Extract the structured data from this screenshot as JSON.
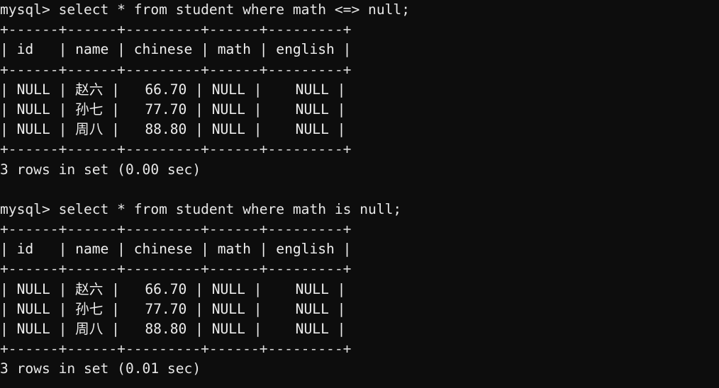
{
  "terminal": {
    "background_color": "#0d0d0d",
    "text_color": "#e8e8e8",
    "prompt": "mysql>",
    "columns": [
      "id",
      "name",
      "chinese",
      "math",
      "english"
    ],
    "separator": "+------+------+---------+------+---------+",
    "header_row": "| id   | name | chinese | math | english |",
    "blank": "",
    "queries": [
      {
        "command_line": "mysql> select * from student where math <=> null;",
        "sql": "select * from student where math <=> null;",
        "rows": [
          "| NULL | 赵六 |   66.70 | NULL |    NULL |",
          "| NULL | 孙七 |   77.70 | NULL |    NULL |",
          "| NULL | 周八 |   88.80 | NULL |    NULL |"
        ],
        "row_values": [
          {
            "id": "NULL",
            "name": "赵六",
            "chinese": "66.70",
            "math": "NULL",
            "english": "NULL"
          },
          {
            "id": "NULL",
            "name": "孙七",
            "chinese": "77.70",
            "math": "NULL",
            "english": "NULL"
          },
          {
            "id": "NULL",
            "name": "周八",
            "chinese": "88.80",
            "math": "NULL",
            "english": "NULL"
          }
        ],
        "status": "3 rows in set (0.00 sec)",
        "row_count": 3,
        "elapsed": "0.00 sec"
      },
      {
        "command_line": "mysql> select * from student where math is null;",
        "sql": "select * from student where math is null;",
        "rows": [
          "| NULL | 赵六 |   66.70 | NULL |    NULL |",
          "| NULL | 孙七 |   77.70 | NULL |    NULL |",
          "| NULL | 周八 |   88.80 | NULL |    NULL |"
        ],
        "row_values": [
          {
            "id": "NULL",
            "name": "赵六",
            "chinese": "66.70",
            "math": "NULL",
            "english": "NULL"
          },
          {
            "id": "NULL",
            "name": "孙七",
            "chinese": "77.70",
            "math": "NULL",
            "english": "NULL"
          },
          {
            "id": "NULL",
            "name": "周八",
            "chinese": "88.80",
            "math": "NULL",
            "english": "NULL"
          }
        ],
        "status": "3 rows in set (0.01 sec)",
        "row_count": 3,
        "elapsed": "0.01 sec"
      }
    ]
  }
}
